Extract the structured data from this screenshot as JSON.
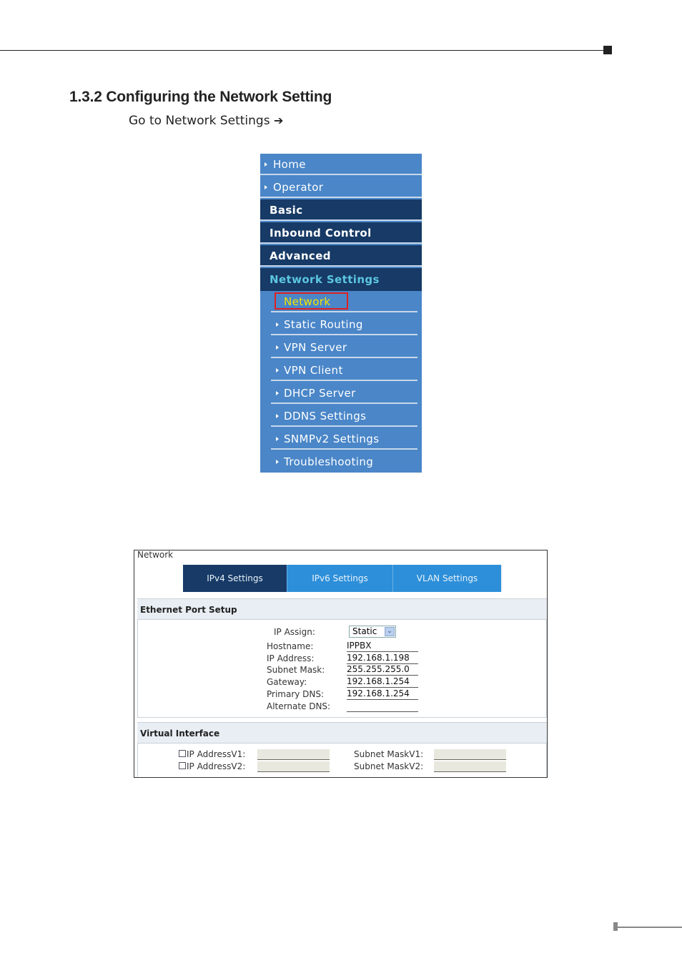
{
  "document": {
    "heading": "1.3.2 Configuring the Network Setting",
    "instruction": "Go to Network Settings",
    "instruction_arrow": "➔"
  },
  "menu": {
    "items": [
      {
        "label": "Home",
        "style": "link"
      },
      {
        "label": "Operator",
        "style": "link"
      },
      {
        "label": "Basic",
        "style": "section"
      },
      {
        "label": "Inbound Control",
        "style": "section"
      },
      {
        "label": "Advanced",
        "style": "section"
      },
      {
        "label": "Network Settings",
        "style": "section-active"
      }
    ],
    "subitems": [
      {
        "label": "Network",
        "selected": true
      },
      {
        "label": "Static Routing"
      },
      {
        "label": "VPN Server"
      },
      {
        "label": "VPN Client"
      },
      {
        "label": "DHCP Server"
      },
      {
        "label": "DDNS Settings"
      },
      {
        "label": "SNMPv2 Settings"
      },
      {
        "label": "Troubleshooting"
      }
    ]
  },
  "network_panel": {
    "title": "Network",
    "tabs": [
      {
        "label": "IPv4 Settings",
        "active": true
      },
      {
        "label": "IPv6 Settings",
        "active": false
      },
      {
        "label": "VLAN Settings",
        "active": false
      }
    ],
    "ethernet": {
      "title": "Ethernet Port Setup",
      "ip_assign_label": "IP Assign:",
      "ip_assign_value": "Static",
      "fields": [
        {
          "label": "Hostname:",
          "value": "IPPBX"
        },
        {
          "label": "IP Address:",
          "value": "192.168.1.198"
        },
        {
          "label": "Subnet Mask:",
          "value": "255.255.255.0"
        },
        {
          "label": "Gateway:",
          "value": "192.168.1.254"
        },
        {
          "label": "Primary DNS:",
          "value": "192.168.1.254"
        },
        {
          "label": "Alternate DNS:",
          "value": ""
        }
      ]
    },
    "virtual": {
      "title": "Virtual Interface",
      "ip1_label": "IP AddressV1:",
      "ip2_label": "IP AddressV2:",
      "mask1_label": "Subnet MaskV1:",
      "mask2_label": "Subnet MaskV2:",
      "ip1_value": "",
      "ip2_value": "",
      "mask1_value": "",
      "mask2_value": ""
    }
  },
  "colors": {
    "menu_light": "#4a86c8",
    "menu_dark": "#173a66",
    "active_section_text": "#5cc6e0",
    "selected_text": "#f2e600",
    "highlight_box": "#e02020",
    "tab_active": "#173a66",
    "tab_inactive": "#2d8fd9"
  }
}
